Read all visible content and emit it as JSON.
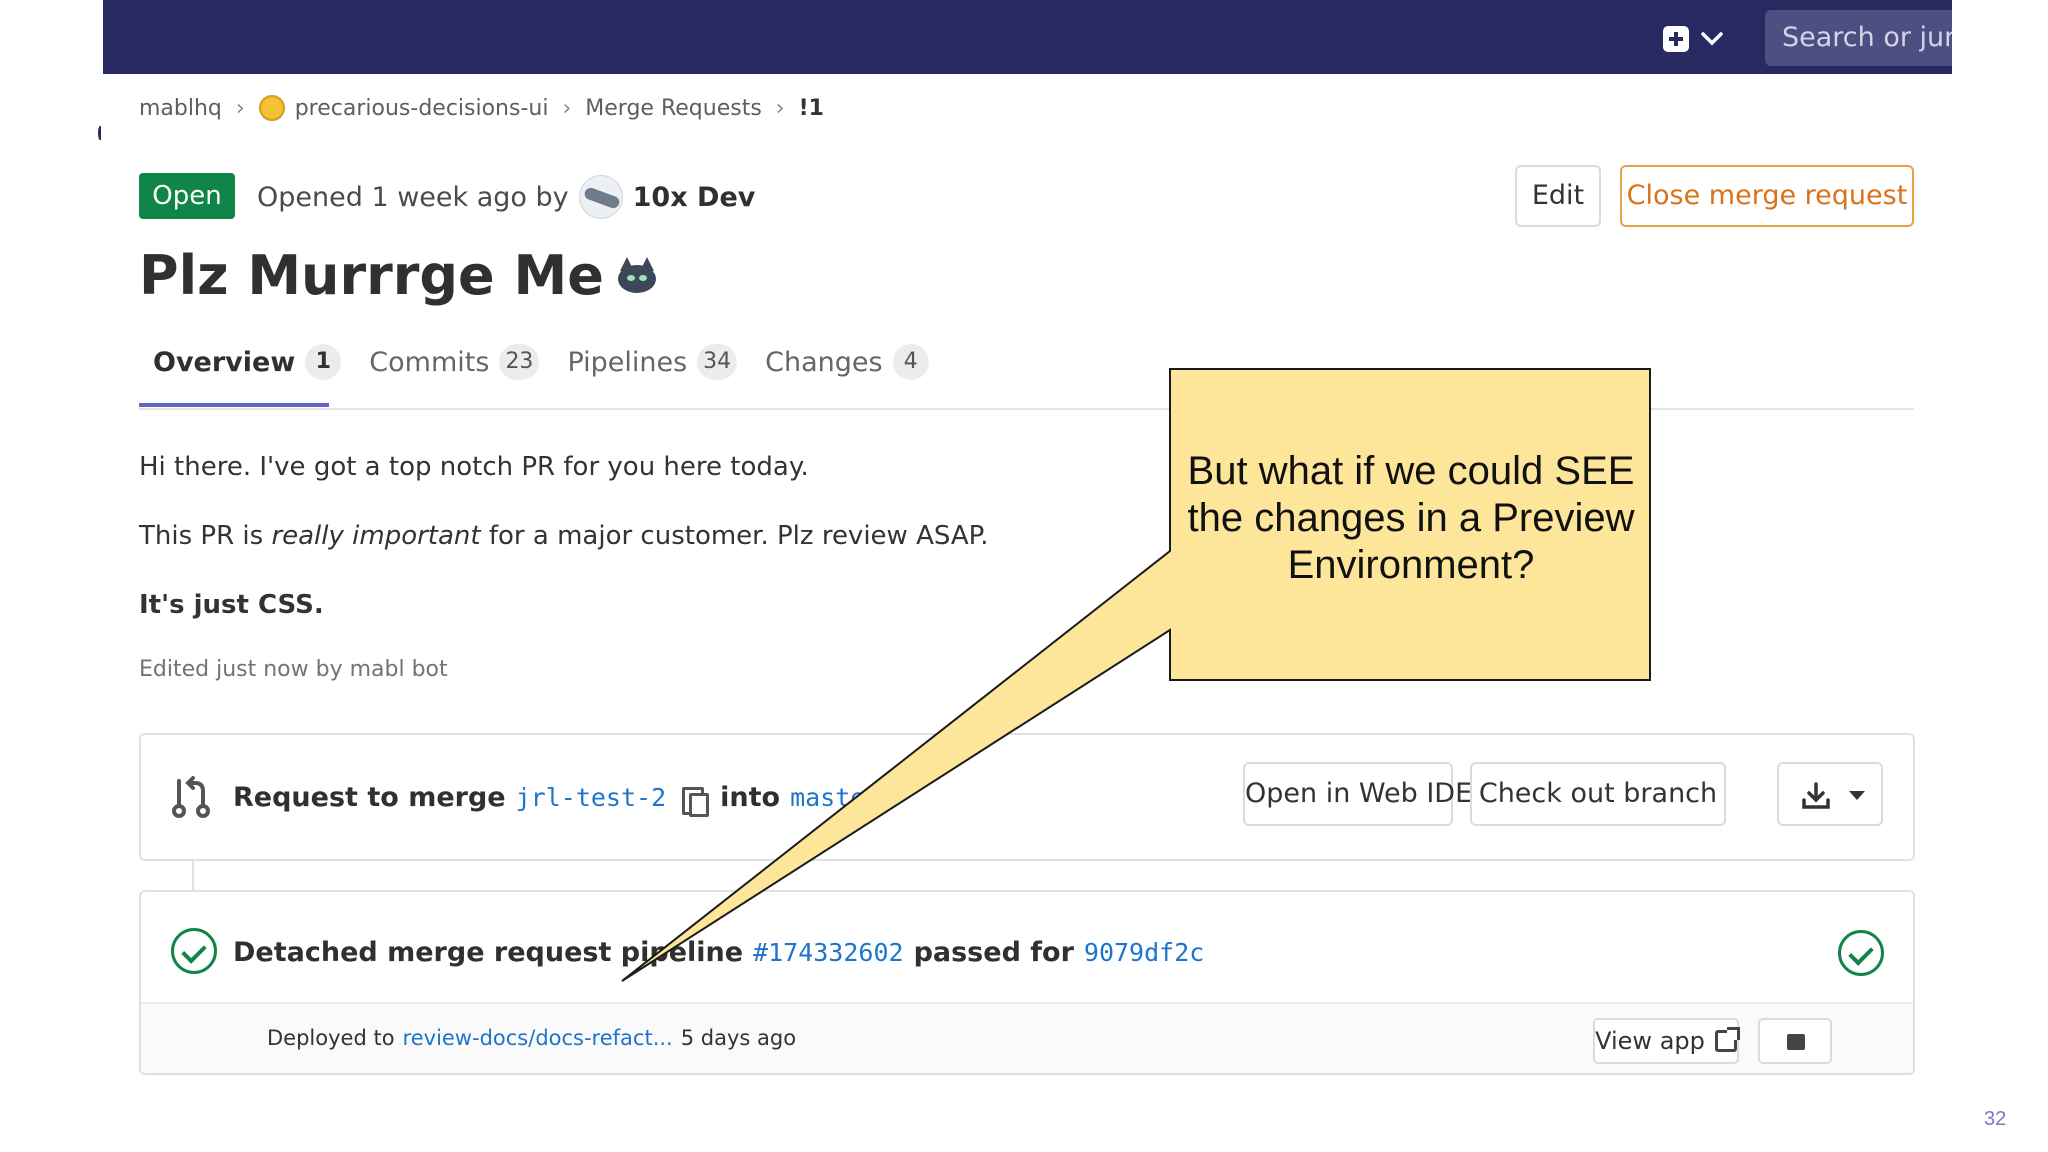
{
  "header": {
    "search_placeholder": "Search or jump to…"
  },
  "breadcrumb": {
    "group": "mablhq",
    "project": "precarious-decisions-ui",
    "section": "Merge Requests",
    "current": "!1"
  },
  "merge_request": {
    "status": "Open",
    "opened_text": "Opened 1 week ago by",
    "author": "10x Dev",
    "title": "Plz Murrrge Me",
    "edit_label": "Edit",
    "close_label": "Close merge request"
  },
  "tabs": [
    {
      "label": "Overview",
      "count": "1"
    },
    {
      "label": "Commits",
      "count": "23"
    },
    {
      "label": "Pipelines",
      "count": "34"
    },
    {
      "label": "Changes",
      "count": "4"
    }
  ],
  "description": {
    "line1": "Hi there. I've got a top notch PR for you here today.",
    "line2_pre": "This PR is ",
    "line2_em": "really important",
    "line2_post": " for a major customer. Plz review ASAP.",
    "line3": "It's just CSS.",
    "edited": "Edited just now by mabl bot"
  },
  "merge_widget": {
    "request_label": "Request to merge",
    "source_branch": "jrl-test-2",
    "into_label": "into",
    "target_branch": "master",
    "open_ide_label": "Open in Web IDE",
    "checkout_label": "Check out branch"
  },
  "pipeline": {
    "label": "Detached merge request pipeline",
    "id": "#174332602",
    "passed_label": "passed for",
    "commit": "9079df2c",
    "deployed_label": "Deployed to",
    "environment": "review-docs/docs-refact...",
    "deployed_when": "5 days ago",
    "view_app_label": "View app"
  },
  "callout": {
    "text": "But what if we could SEE the changes in a Preview Environment?"
  },
  "slide_number": "32",
  "colors": {
    "nav_bg": "#292961",
    "open_green": "#108548",
    "close_orange": "#d9731b",
    "link_blue": "#1f75cb",
    "callout_fill": "#fde69a",
    "tab_active": "#6666c4"
  },
  "icons": [
    "plus-square-icon",
    "chevron-down-icon",
    "project-avatar-icon",
    "cat-emoji-icon",
    "merge-request-icon",
    "copy-icon",
    "download-icon",
    "check-circle-icon",
    "external-link-icon",
    "stop-icon"
  ]
}
